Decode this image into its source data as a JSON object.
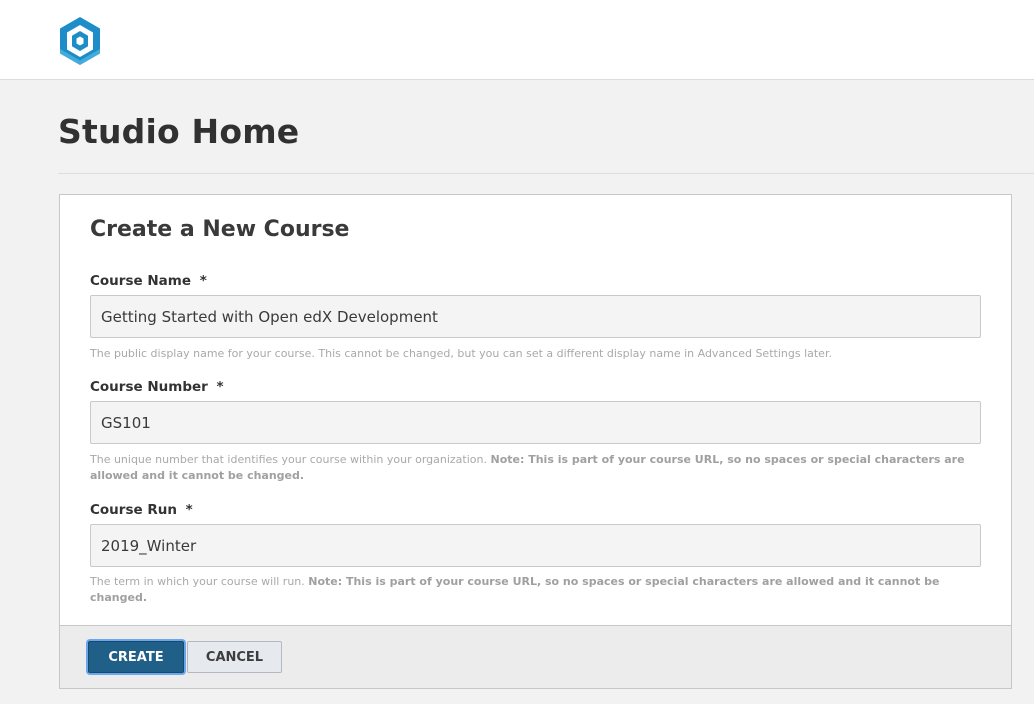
{
  "header": {
    "logo_icon": "open-edx-hexagon-logo-icon"
  },
  "page": {
    "title": "Studio Home"
  },
  "form": {
    "title": "Create a New Course",
    "course_name": {
      "label": "Course Name",
      "required_mark": "*",
      "value": "Getting Started with Open edX Development",
      "help": "The public display name for your course. This cannot be changed, but you can set a different display name in Advanced Settings later."
    },
    "course_number": {
      "label": "Course Number",
      "required_mark": "*",
      "value": "GS101",
      "help": "The unique number that identifies your course within your organization.",
      "help_note": "Note: This is part of your course URL, so no spaces or special characters are allowed and it cannot be changed."
    },
    "course_run": {
      "label": "Course Run",
      "required_mark": "*",
      "value": "2019_Winter",
      "help": "The term in which your course will run.",
      "help_note": "Note: This is part of your course URL, so no spaces or special characters are allowed and it cannot be changed."
    },
    "buttons": {
      "create": "CREATE",
      "cancel": "CANCEL"
    }
  },
  "colors": {
    "primary_button": "#1f5f88",
    "logo_blue": "#1c8dc8",
    "page_background": "#f2f2f2"
  }
}
